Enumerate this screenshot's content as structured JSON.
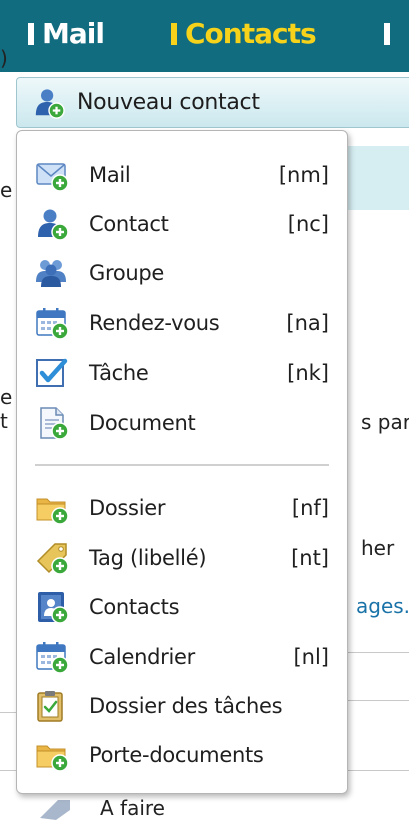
{
  "top_tabs": [
    {
      "label": "Mail",
      "active": false
    },
    {
      "label": "Contacts",
      "active": true
    },
    {
      "label": "",
      "active": false
    }
  ],
  "background_fragments": {
    "paren": ")",
    "e1": "e",
    "e2": "e",
    "t": "t",
    "s_par": "s par",
    "her": "her",
    "ages": "ages.",
    "a_faire": "A faire"
  },
  "new_button": {
    "label": "Nouveau contact",
    "icon": "new-contact-icon"
  },
  "menu": {
    "items": [
      {
        "label": "Mail",
        "shortcut": "[nm]",
        "icon": "mail-icon"
      },
      {
        "label": "Contact",
        "shortcut": "[nc]",
        "icon": "contact-icon"
      },
      {
        "label": "Groupe",
        "shortcut": "",
        "icon": "group-icon"
      },
      {
        "label": "Rendez-vous",
        "shortcut": "[na]",
        "icon": "appointment-icon"
      },
      {
        "label": "Tâche",
        "shortcut": "[nk]",
        "icon": "task-icon"
      },
      {
        "label": "Document",
        "shortcut": "",
        "icon": "document-icon"
      },
      {
        "label": "Dossier",
        "shortcut": "[nf]",
        "icon": "folder-icon"
      },
      {
        "label": "Tag (libellé)",
        "shortcut": "[nt]",
        "icon": "tag-icon"
      },
      {
        "label": "Contacts",
        "shortcut": "",
        "icon": "address-book-icon"
      },
      {
        "label": "Calendrier",
        "shortcut": "[nl]",
        "icon": "calendar-icon"
      },
      {
        "label": "Dossier des tâches",
        "shortcut": "",
        "icon": "task-folder-icon"
      },
      {
        "label": "Porte-documents",
        "shortcut": "",
        "icon": "briefcase-folder-icon"
      }
    ]
  },
  "colors": {
    "topbar": "#126c7f",
    "active_tab": "#f6d21a",
    "button_gradient_top": "#eef8fa",
    "button_gradient_bottom": "#cbe8ee",
    "background_strip": "#d6eef2",
    "link": "#1a73a8"
  }
}
